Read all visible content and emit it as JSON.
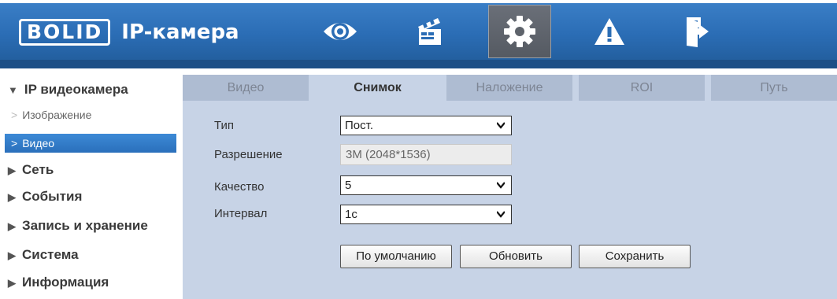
{
  "header": {
    "logo_text": "BOLID",
    "app_title": "IP-камера",
    "nav_icons": [
      "eye-icon",
      "clapperboard-icon",
      "gear-icon",
      "warning-icon",
      "exit-icon"
    ],
    "active_nav": "gear-icon"
  },
  "sidebar": {
    "groups": [
      {
        "label": "IP видеокамера",
        "expanded": true,
        "items": [
          {
            "label": "Изображение"
          },
          {
            "label": "Видео",
            "active": true
          }
        ]
      },
      {
        "label": "Сеть"
      },
      {
        "label": "События"
      },
      {
        "label": "Запись и хранение"
      },
      {
        "label": "Система"
      },
      {
        "label": "Информация"
      }
    ]
  },
  "tabs": [
    {
      "label": "Видео"
    },
    {
      "label": "Снимок",
      "active": true
    },
    {
      "label": "Наложение"
    },
    {
      "label": "ROI"
    },
    {
      "label": "Путь"
    }
  ],
  "form": {
    "type": {
      "label": "Тип",
      "value": "Пост."
    },
    "resolution": {
      "label": "Разрешение",
      "value": "3M (2048*1536)"
    },
    "quality": {
      "label": "Качество",
      "value": "5"
    },
    "interval": {
      "label": "Интервал",
      "value": "1с"
    }
  },
  "buttons": {
    "default": "По умолчанию",
    "refresh": "Обновить",
    "save": "Сохранить"
  },
  "colors": {
    "header_blue": "#2b6db5",
    "content_bg": "#c7d3e6",
    "active_item": "#2a6fbb"
  }
}
